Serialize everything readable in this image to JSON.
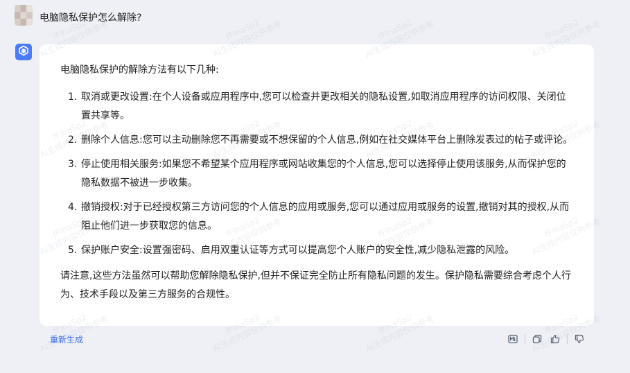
{
  "user": {
    "question": "电脑隐私保护怎么解除?"
  },
  "answer": {
    "intro": "电脑隐私保护的解除方法有以下几种:",
    "items": [
      {
        "num": "1.",
        "text": "取消或更改设置:在个人设备或应用程序中,您可以检查并更改相关的隐私设置,如取消应用程序的访问权限、关闭位置共享等。"
      },
      {
        "num": "2.",
        "text": "删除个人信息:您可以主动删除您不再需要或不想保留的个人信息,例如在社交媒体平台上删除发表过的帖子或评论。"
      },
      {
        "num": "3.",
        "text": "停止使用相关服务:如果您不希望某个应用程序或网站收集您的个人信息,您可以选择停止使用该服务,从而保护您的隐私数据不被进一步收集。"
      },
      {
        "num": "4.",
        "text": "撤销授权:对于已经授权第三方访问您的个人信息的应用或服务,您可以通过应用或服务的设置,撤销对其的授权,从而阻止他们进一步获取您的信息。"
      },
      {
        "num": "5.",
        "text": "保护账户安全:设置强密码、启用双重认证等方式可以提高您个人账户的安全性,减少隐私泄露的风险。"
      }
    ],
    "closing": "请注意,这些方法虽然可以帮助您解除隐私保护,但并不保证完全防止所有隐私问题的发生。保护隐私需要综合考虑个人行为、技术手段以及第三方服务的合规性。"
  },
  "footer": {
    "regenerate_label": "重新生成"
  },
  "watermark": {
    "line1": "fFlhaSp2",
    "line2": "AI生成内容仅供参考"
  },
  "colors": {
    "accent": "#3a6fe8",
    "bot_avatar": "#4b7cf5",
    "page_bg": "#eef0f6",
    "card_bg": "#ffffff"
  },
  "icons": [
    "cube-logo-icon",
    "markdown-icon",
    "copy-icon",
    "thumbs-up-icon",
    "thumbs-down-icon"
  ]
}
